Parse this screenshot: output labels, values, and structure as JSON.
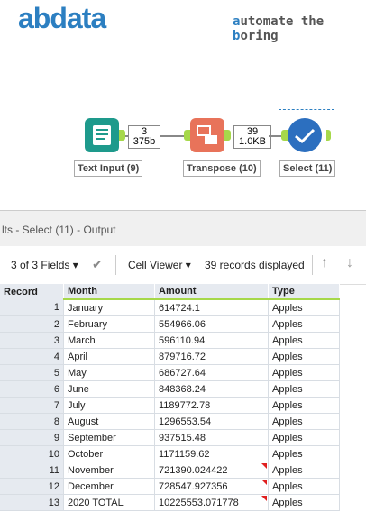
{
  "logo": {
    "text": "abdata"
  },
  "tagline": {
    "a": "a",
    "b": "utomate the ",
    "c": "b",
    "d": "oring"
  },
  "workflow": {
    "tools": [
      {
        "label": "Text Input (9)",
        "badge_top": "3",
        "badge_bottom": "375b",
        "color": "#1e9a8c"
      },
      {
        "label": "Transpose (10)",
        "badge_top": "39",
        "badge_bottom": "1.0KB",
        "color": "#e8735a"
      },
      {
        "label": "Select (11)",
        "color": "#2c6fbf"
      }
    ]
  },
  "panel": {
    "title": "lts - Select (11) - Output"
  },
  "toolbar": {
    "fields": "3 of 3 Fields",
    "viewer": "Cell Viewer",
    "records": "39 records displayed"
  },
  "table": {
    "headers": [
      "Record",
      "Month",
      "Amount",
      "Type"
    ],
    "rows": [
      {
        "rec": "1",
        "month": "January",
        "amount": "614724.1",
        "type": "Apples",
        "flag": false
      },
      {
        "rec": "2",
        "month": "February",
        "amount": "554966.06",
        "type": "Apples",
        "flag": false
      },
      {
        "rec": "3",
        "month": "March",
        "amount": "596110.94",
        "type": "Apples",
        "flag": false
      },
      {
        "rec": "4",
        "month": "April",
        "amount": "879716.72",
        "type": "Apples",
        "flag": false
      },
      {
        "rec": "5",
        "month": "May",
        "amount": "686727.64",
        "type": "Apples",
        "flag": false
      },
      {
        "rec": "6",
        "month": "June",
        "amount": "848368.24",
        "type": "Apples",
        "flag": false
      },
      {
        "rec": "7",
        "month": "July",
        "amount": "1189772.78",
        "type": "Apples",
        "flag": false
      },
      {
        "rec": "8",
        "month": "August",
        "amount": "1296553.54",
        "type": "Apples",
        "flag": false
      },
      {
        "rec": "9",
        "month": "September",
        "amount": "937515.48",
        "type": "Apples",
        "flag": false
      },
      {
        "rec": "10",
        "month": "October",
        "amount": "1171159.62",
        "type": "Apples",
        "flag": false
      },
      {
        "rec": "11",
        "month": "November",
        "amount": "721390.024422",
        "type": "Apples",
        "flag": true
      },
      {
        "rec": "12",
        "month": "December",
        "amount": "728547.927356",
        "type": "Apples",
        "flag": true
      },
      {
        "rec": "13",
        "month": "2020 TOTAL",
        "amount": "10225553.071778",
        "type": "Apples",
        "flag": true
      }
    ]
  }
}
